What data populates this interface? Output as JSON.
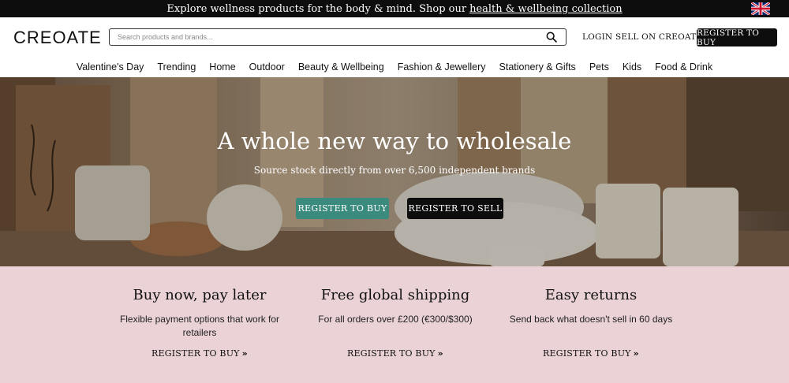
{
  "announcement": {
    "text": "Explore wellness products for the body & mind. Shop our",
    "link": "health & wellbeing collection",
    "flag_icon": "uk-flag-icon"
  },
  "header": {
    "logo": "CREOATE",
    "search_placeholder": "Search products and brands...",
    "search_icon": "search-icon",
    "login": "LOGIN",
    "sell": "SELL ON CREOATE",
    "register": "REGISTER TO BUY"
  },
  "categories": [
    "Valentine's Day",
    "Trending",
    "Home",
    "Outdoor",
    "Beauty & Wellbeing",
    "Fashion & Jewellery",
    "Stationery & Gifts",
    "Pets",
    "Kids",
    "Food & Drink"
  ],
  "hero": {
    "title": "A whole new way to wholesale",
    "subtitle": "Source stock directly from over 6,500 independent brands",
    "buy_button": "REGISTER TO BUY",
    "sell_button": "REGISTER TO SELL"
  },
  "benefits": [
    {
      "title": "Buy now, pay later",
      "text": "Flexible payment options that work for retailers",
      "cta": "REGISTER TO BUY"
    },
    {
      "title": "Free global shipping",
      "text": "For all orders over £200 (€300/$300)",
      "cta": "REGISTER TO BUY"
    },
    {
      "title": "Easy returns",
      "text": "Send back what doesn't sell in 60 days",
      "cta": "REGISTER TO BUY"
    }
  ],
  "colors": {
    "accent": "#3a8a7e",
    "dark": "#0d0d0d",
    "benefits_bg": "#ead2d6"
  }
}
